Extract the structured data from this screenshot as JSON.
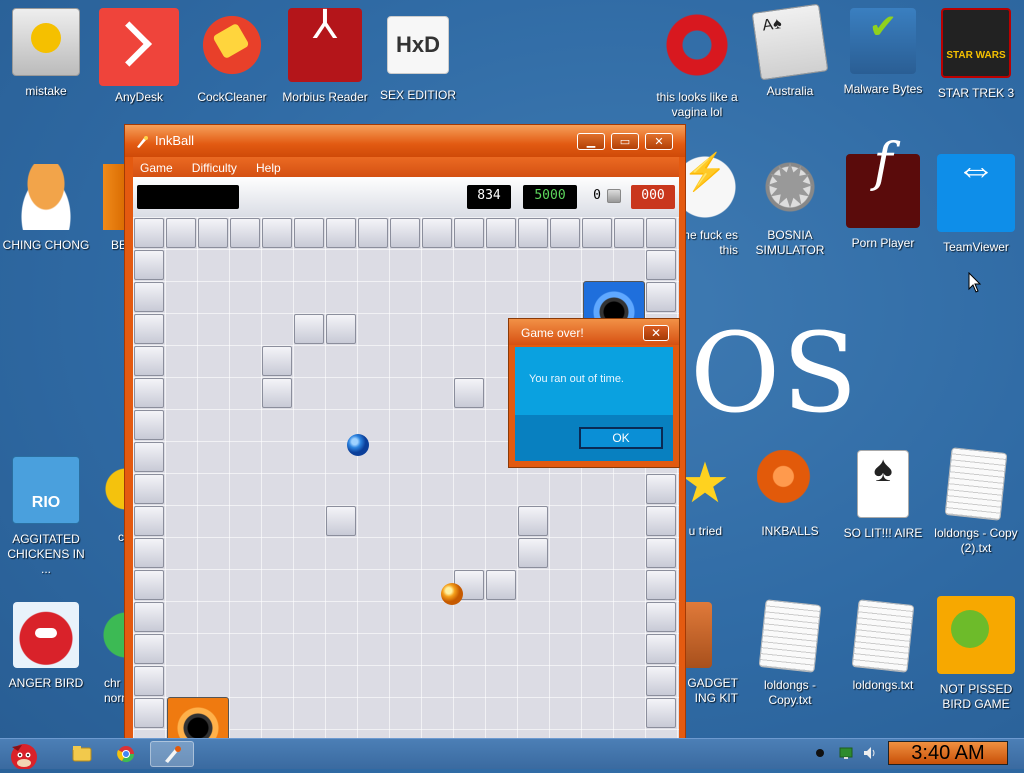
{
  "desktop": {
    "icons": {
      "mistake": {
        "label": "mistake",
        "icon": "computer-icon"
      },
      "anydesk": {
        "label": "AnyDesk",
        "icon": "anydesk-icon"
      },
      "cockcleaner": {
        "label": "CockCleaner",
        "icon": "ccleaner-icon"
      },
      "morbius": {
        "label": "Morbius Reader",
        "icon": "pdf-reader-icon"
      },
      "sexeditior": {
        "label": "SEX EDITIOR",
        "icon": "hex-editor-icon"
      },
      "opera": {
        "label": "this looks like a vagina lol",
        "icon": "opera-icon"
      },
      "australia": {
        "label": "Australia",
        "icon": "spider-solitaire-icon"
      },
      "malwarebytes": {
        "label": "Malware Bytes",
        "icon": "shield-icon"
      },
      "startrek": {
        "label": "STAR TREK 3",
        "icon": "star-wars-icon"
      },
      "chingchong": {
        "label": "CHING CHONG",
        "icon": "egg-icon"
      },
      "be": {
        "label": "BE",
        "icon": "cone-icon"
      },
      "thefuck": {
        "label": "the fuck es this",
        "icon": "lightning-icon"
      },
      "bosnia": {
        "label": "BOSNIA SIMULATOR",
        "icon": "mine-icon"
      },
      "pornplayer": {
        "label": "Porn Player",
        "icon": "flash-icon"
      },
      "teamviewer": {
        "label": "TeamViewer",
        "icon": "teamviewer-icon"
      },
      "aggitated": {
        "label": "AGGITATED CHICKENS IN ...",
        "icon": "angry-birds-rio-icon"
      },
      "c": {
        "label": "c",
        "icon": "chrome-icon"
      },
      "youtried": {
        "label": "u tried",
        "icon": "star-icon"
      },
      "inkballs": {
        "label": "INKBALLS",
        "icon": "inkball-icon"
      },
      "solitaire": {
        "label": "SO LIT!!! AIRE",
        "icon": "solitaire-icon"
      },
      "loldongs_copy2": {
        "label": "loldongs - Copy (2).txt",
        "icon": "text-document-icon"
      },
      "angerbird": {
        "label": "ANGER BIRD",
        "icon": "angry-bird-icon"
      },
      "chrome2": {
        "label": "chr norm",
        "icon": "chrome-icon"
      },
      "gadget": {
        "label": "D GADGET ING KIT",
        "icon": "toolbox-icon"
      },
      "loldongs_copy": {
        "label": "loldongs - Copy.txt",
        "icon": "text-document-icon"
      },
      "loldongs": {
        "label": "loldongs.txt",
        "icon": "text-document-icon"
      },
      "notpissed": {
        "label": "NOT PISSED BIRD GAME",
        "icon": "green-pig-icon"
      }
    },
    "wallpaper_text": "OS"
  },
  "inkball": {
    "title": "InkBall",
    "menu": [
      "Game",
      "Difficulty",
      "Help"
    ],
    "toolbar": {
      "score": "834",
      "target": "5000",
      "balls_count": "0",
      "timer": "000"
    }
  },
  "dialog": {
    "title": "Game over!",
    "message": "You ran out of time.",
    "ok_label": "OK",
    "close_label": "✕"
  },
  "taskbar": {
    "clock": "3:40 AM"
  },
  "colors": {
    "accent": "#e45a10",
    "dialog_body": "#0aa1e0",
    "desktop_bg": "#2f6aa4"
  }
}
